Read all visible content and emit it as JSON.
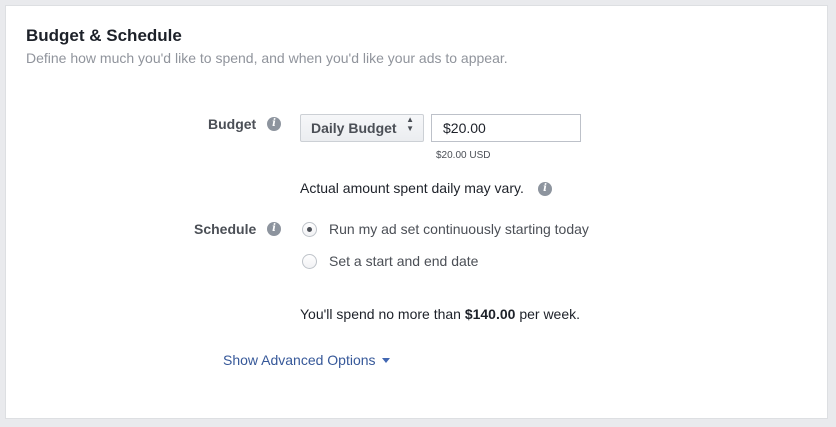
{
  "section": {
    "title": "Budget & Schedule",
    "subtitle": "Define how much you'd like to spend, and when you'd like your ads to appear."
  },
  "budget": {
    "label": "Budget",
    "info_icon": "info-icon",
    "type_select": "Daily Budget",
    "caret_icon": "sort-arrows-icon",
    "amount_value": "$20.00",
    "amount_usd": "$20.00 USD",
    "note": "Actual amount spent daily may vary."
  },
  "schedule": {
    "label": "Schedule",
    "options": [
      {
        "label": "Run my ad set continuously starting today",
        "checked": true
      },
      {
        "label": "Set a start and end date",
        "checked": false
      }
    ]
  },
  "weekly": {
    "prefix": "You'll spend no more than ",
    "amount": "$140.00",
    "suffix": " per week."
  },
  "advanced": {
    "label": "Show Advanced Options",
    "icon": "caret-down-icon"
  },
  "colors": {
    "link": "#365899",
    "page_bg": "#e9eaed",
    "panel_bg": "#ffffff"
  }
}
